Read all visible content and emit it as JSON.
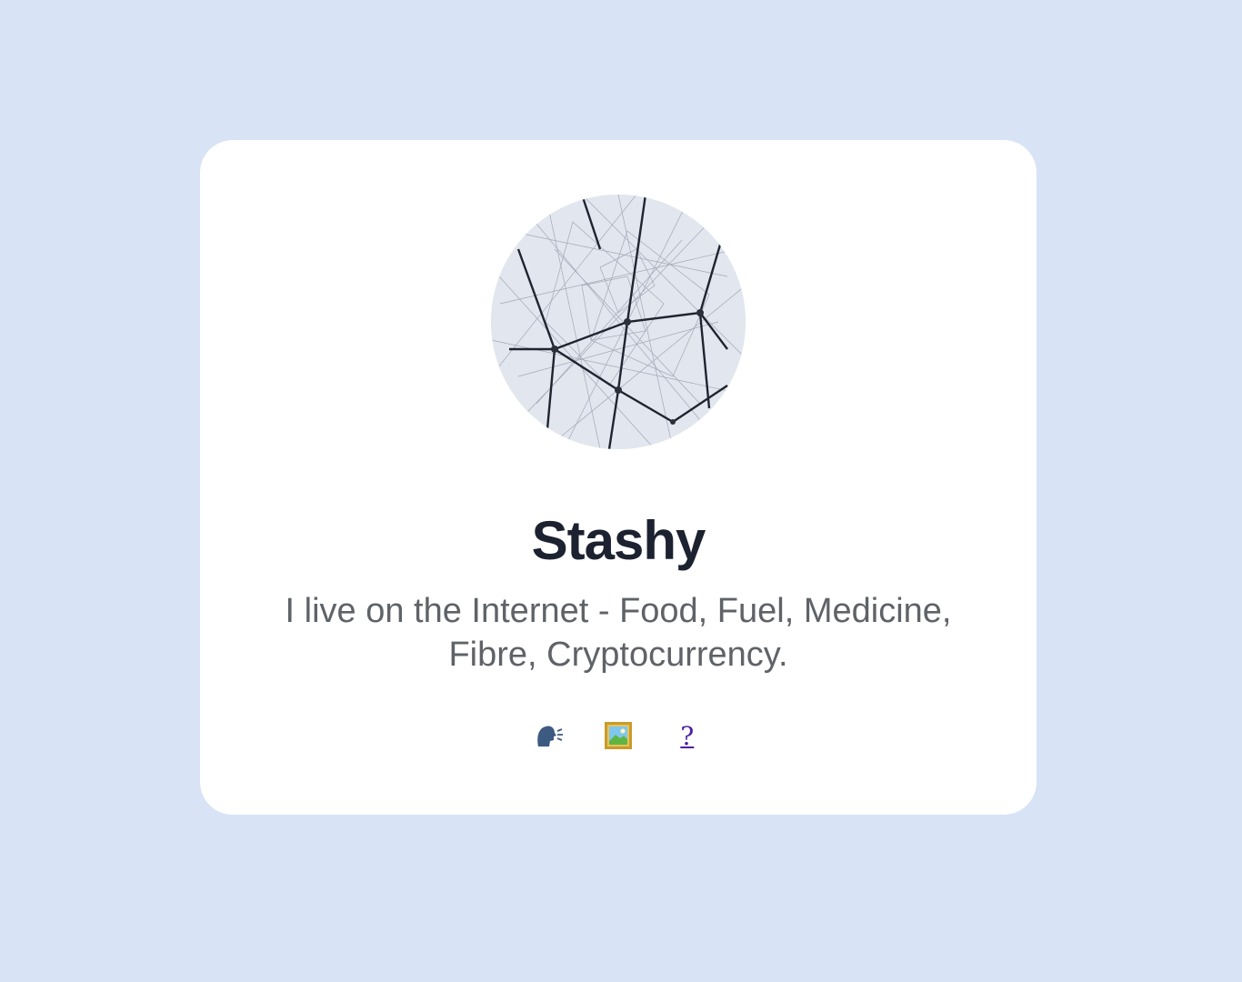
{
  "profile": {
    "name": "Stashy",
    "bio": "I live on the Internet - Food, Fuel, Medicine, Fibre, Cryptocurrency."
  },
  "links": [
    {
      "icon": "speaking-head-icon",
      "label": ""
    },
    {
      "icon": "framed-picture-icon",
      "label": ""
    },
    {
      "icon": "question-mark-icon",
      "label": "?"
    }
  ],
  "colors": {
    "background": "#d8e3f6",
    "card": "#ffffff",
    "name": "#1d2230",
    "bio": "#5f6368",
    "link": "#4b1fa0"
  }
}
